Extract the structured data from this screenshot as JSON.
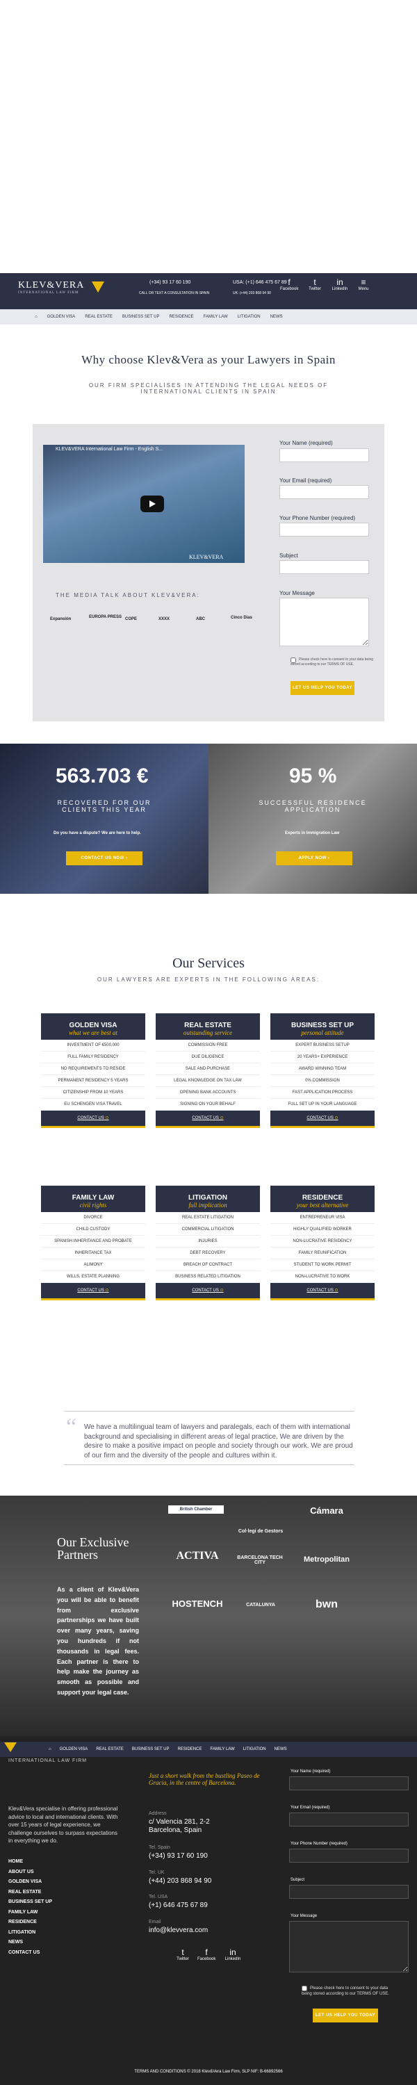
{
  "header": {
    "logo": "KLEV&VERA",
    "logo_sub": "INTERNATIONAL LAW FIRM",
    "phone_spain": "(+34) 93 17 60 190",
    "phone_usa": "USA: (+1) 646 475 67 89",
    "cta": "CALL OR TEXT A CONSULTATION IN SPAIN",
    "phone_uk": "UK: (+44) 203 868 94 90",
    "social": [
      {
        "icon": "facebook-icon",
        "glyph": "f",
        "label": "Facebook"
      },
      {
        "icon": "twitter-icon",
        "glyph": "t",
        "label": "Twitter"
      },
      {
        "icon": "linkedin-icon",
        "glyph": "in",
        "label": "LinkedIn"
      }
    ],
    "menu_label": "Menu"
  },
  "nav": [
    "GOLDEN VISA",
    "REAL ESTATE",
    "BUSINESS SET UP",
    "RESIDENCE",
    "FAMILY LAW",
    "LITIGATION",
    "NEWS"
  ],
  "why": {
    "title": "Why choose Klev&Vera as your Lawyers in Spain",
    "subtitle": "OUR FIRM SPECIALISES IN ATTENDING THE LEGAL NEEDS OF INTERNATIONAL CLIENTS IN SPAIN",
    "video_title": "KLEV&VERA International Law Firm - English S...",
    "video_logo": "KLEV&VERA",
    "media_title": "THE MEDIA TALK ABOUT KLEV&VERA:",
    "media": [
      "Expansión",
      "EUROPA PRESS",
      "COPE",
      "XXXX",
      "ABC",
      "Cinco Dias"
    ]
  },
  "form": {
    "name": "Your Name (required)",
    "email": "Your Email (required)",
    "phone": "Your Phone Number (required)",
    "subject": "Subject",
    "message": "Your Message",
    "consent": "Please check here to consent to your data being stored according to our TERMS OF USE.",
    "button": "LET US HELP YOU TODAY"
  },
  "stats": {
    "left": {
      "number": "563.703 €",
      "caption": "RECOVERED FOR OUR CLIENTS THIS YEAR",
      "sub": "Do you have a dispute? We are here to help.",
      "button": "CONTACT US NOW"
    },
    "right": {
      "number": "95 %",
      "caption": "SUCCESSFUL RESIDENCE APPLICATION",
      "sub": "Experts in Immigration Law",
      "button": "APPLY NOW"
    }
  },
  "services": {
    "title": "Our Services",
    "subtitle": "OUR LAWYERS ARE EXPERTS IN THE FOLLOWING AREAS:",
    "cards": [
      {
        "title": "GOLDEN VISA",
        "tagline": "what we are best at",
        "items": [
          "INVESTMENT OF €500,000",
          "FULL FAMILY RESIDENCY",
          "NO REQUIREMENTS TO RESIDE",
          "PERMANENT RESIDENCY 5 YEARS",
          "CITIZENSHIP FROM 10 YEARS",
          "EU SCHENGEN VISA TRAVEL"
        ],
        "footer": "CONTACT US"
      },
      {
        "title": "REAL ESTATE",
        "tagline": "outstanding service",
        "items": [
          "COMMISSION FREE",
          "DUE DILIGENCE",
          "SALE AND PURCHASE",
          "LEGAL KNOWLEDGE ON TAX LAW",
          "OPENING BANK ACCOUNTS",
          "SIGNING ON YOUR BEHALF"
        ],
        "footer": "CONTACT US"
      },
      {
        "title": "BUSINESS SET UP",
        "tagline": "personal attitude",
        "items": [
          "EXPERT BUSINESS SETUP",
          "20 YEARS+ EXPERIENCE",
          "AWARD WINNING TEAM",
          "0% COMMISSION",
          "FAST APPLICATION PROCESS",
          "FULL SET UP IN YOUR LANGUAGE"
        ],
        "footer": "CONTACT US"
      },
      {
        "title": "FAMILY LAW",
        "tagline": "civil rights",
        "items": [
          "DIVORCE",
          "CHILD CUSTODY",
          "SPANISH INHERITANCE AND PROBATE",
          "INHERITANCE TAX",
          "ALIMONY",
          "WILLS, ESTATE PLANNING"
        ],
        "footer": "CONTACT US"
      },
      {
        "title": "LITIGATION",
        "tagline": "full implication",
        "items": [
          "REAL ESTATE LITIGATION",
          "COMMERCIAL LITIGATION",
          "INJURIES",
          "DEBT RECOVERY",
          "BREACH OF CONTRACT",
          "BUSINESS RELATED LITIGATION"
        ],
        "footer": "CONTACT US"
      },
      {
        "title": "RESIDENCE",
        "tagline": "your best alternative",
        "items": [
          "ENTREPRENEUR VISA",
          "HIGHLY QUALIFIED WORKER",
          "NON-LUCRATIVE RESIDENCY",
          "FAMILY REUNIFICATION",
          "STUDENT TO WORK PERMIT",
          "NON-LUCRATIVE TO WORK"
        ],
        "footer": "CONTACT US"
      }
    ]
  },
  "quote": "We have a multilingual team of lawyers and paralegals, each of them with international background and specialising in different areas of legal practice. We are driven by the desire to make a positive impact on people and society through our work. We are proud of our firm and the diversity of the people and cultures within it.",
  "partners": {
    "title": "Our Exclusive Partners",
    "text": "As a client of Klev&Vera you will be able to benefit from exclusive partnerships we have built over many years, saving you hundreds if not thousands in legal fees. Each partner is there to help make the journey as smooth as possible and support your legal case.",
    "logos": [
      "British Chamber",
      "Col·legi de Gestors",
      "Cámara",
      "ACTIVA",
      "BARCELONA TECH CITY",
      "Metropolitan",
      "HOSTENCH",
      "CATALUNYA",
      "bwn"
    ]
  },
  "footer": {
    "nav": [
      "GOLDEN VISA",
      "REAL ESTATE",
      "BUSINESS SET UP",
      "RESIDENCE",
      "FAMILY LAW",
      "LITIGATION",
      "NEWS"
    ],
    "logo_sub": "INTERNATIONAL LAW FIRM",
    "intro": "Klev&Vera specialise in offering professional advice to local and international clients. With over 15 years of legal experience, we challenge ourselves to surpass expectations in everything we do.",
    "links": [
      "HOME",
      "ABOUT US",
      "GOLDEN VISA",
      "REAL ESTATE",
      "BUSINESS SET UP",
      "FAMILY LAW",
      "RESIDENCE",
      "LITIGATION",
      "NEWS",
      "CONTACT US"
    ],
    "walk": "Just a short walk from the bustling Paseo de Gracia, in the centre of Barcelona.",
    "address_label": "Address",
    "address": [
      "c/ Valencia 281, 2-2",
      "Barcelona, Spain"
    ],
    "tel_spain_label": "Tel. Spain",
    "tel_spain": "(+34) 93 17 60 190",
    "tel_uk_label": "Tel. UK",
    "tel_uk": "(+44) 203 868 94 90",
    "tel_usa_label": "Tel. USA",
    "tel_usa": "(+1) 646 475 67 89",
    "email_label": "Email",
    "email": "info@klevvera.com",
    "social": [
      {
        "icon": "twitter-icon",
        "glyph": "t",
        "label": "Twitter"
      },
      {
        "icon": "facebook-icon",
        "glyph": "f",
        "label": "Facebook"
      },
      {
        "icon": "linkedin-icon",
        "glyph": "in",
        "label": "LinkedIn"
      }
    ],
    "form": {
      "name": "Your Name (required)",
      "email": "Your Email (required)",
      "phone": "Your Phone Number (required)",
      "subject": "Subject",
      "message": "Your Message",
      "consent": "Please check here to consent to your data being stored according to our TERMS OF USE.",
      "button": "LET US HELP YOU TODAY"
    },
    "copyright": "TERMS AND CONDITIONS © 2018 Klev&Vera Law Firm, SLP NIF: B-66892566"
  },
  "colors": {
    "navy": "#2c3145",
    "gold": "#e8b90b",
    "footer": "#222222"
  }
}
